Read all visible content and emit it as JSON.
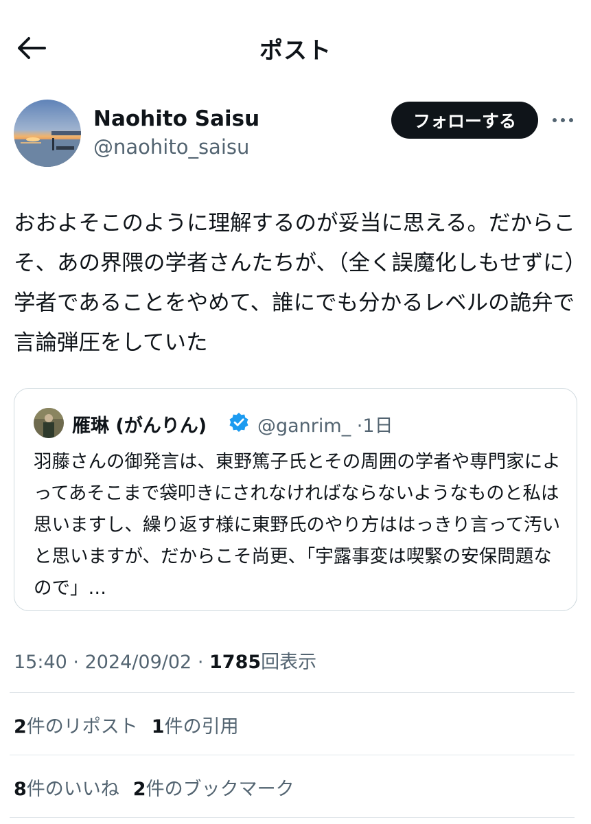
{
  "header": {
    "title": "ポスト",
    "back_icon": "arrow-left-icon"
  },
  "author": {
    "display_name": "Naohito Saisu",
    "handle": "@naohito_saisu",
    "follow_label": "フォローする",
    "more_icon": "more-horizontal-icon"
  },
  "post": {
    "text": "おおよそこのように理解するのが妥当に思える。だからこそ、あの界隈の学者さんたちが、（全く誤魔化しもせずに）学者であることをやめて、誰にでも分かるレベルの詭弁で言論弾圧をしていた"
  },
  "quote": {
    "display_name": "雁琳 (がんりん)",
    "verified_icon": "verified-badge-icon",
    "handle": "@ganrim_",
    "separator": "·",
    "time": "1日",
    "text": "羽藤さんの御発言は、東野篤子氏とその周囲の学者や専門家によってあそこまで袋叩きにされなければならないようなものと私は思いますし、繰り返す様に東野氏のやり方ははっきり言って汚いと思いますが、だからこそ尚更、「宇露事変は喫緊の安保問題なので」…"
  },
  "meta": {
    "time": "15:40",
    "sep1": "·",
    "date": "2024/09/02",
    "sep2": "·",
    "views_count": "1785",
    "views_label": "回表示"
  },
  "stats": {
    "reposts_count": "2",
    "reposts_label": "件のリポスト",
    "quotes_count": "1",
    "quotes_label": "件の引用",
    "likes_count": "8",
    "likes_label": "件のいいね",
    "bookmarks_count": "2",
    "bookmarks_label": "件のブックマーク"
  },
  "colors": {
    "accent": "#1d9bf0",
    "text": "#0f1419",
    "secondary": "#536471",
    "border": "#cfd9de"
  }
}
